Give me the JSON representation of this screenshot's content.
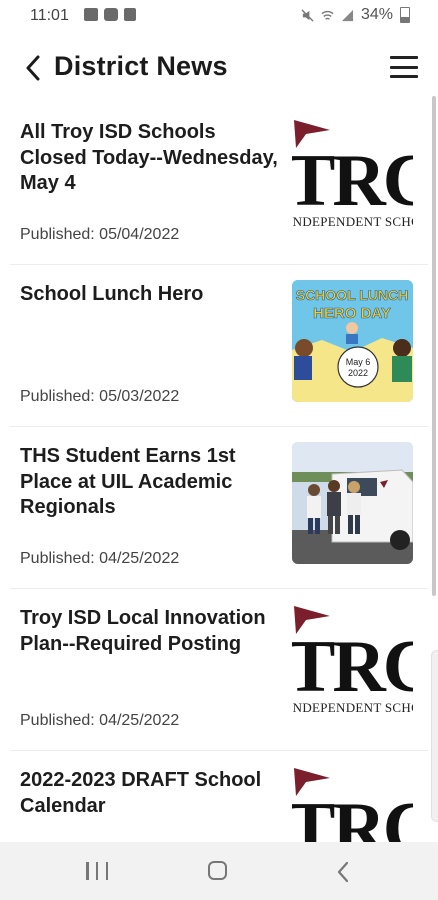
{
  "status_bar": {
    "time": "11:01",
    "battery": "34%",
    "notification_icons": [
      "image-icon",
      "youtube-icon",
      "app-icon"
    ],
    "system_icons": [
      "mute-icon",
      "wifi-icon",
      "signal-icon",
      "battery-icon"
    ]
  },
  "app_bar": {
    "title": "District News",
    "back_icon": "back-arrow-icon",
    "menu_icon": "hamburger-menu-icon"
  },
  "news": [
    {
      "headline": "All Troy ISD Schools Closed Today--Wednesday, May 4",
      "published": "Published: 05/04/2022",
      "thumbnail": "troy-isd-logo"
    },
    {
      "headline": "School Lunch Hero",
      "published": "Published: 05/03/2022",
      "thumbnail": "school-lunch-hero-day-image"
    },
    {
      "headline": "THS Student Earns 1st Place at UIL Academic Regionals",
      "published": "Published: 04/25/2022",
      "thumbnail": "students-photo"
    },
    {
      "headline": "Troy ISD Local Innovation Plan--Required Posting",
      "published": "Published: 04/25/2022",
      "thumbnail": "troy-isd-logo"
    },
    {
      "headline": "2022-2023 DRAFT School Calendar",
      "published": "",
      "thumbnail": "troy-isd-logo"
    }
  ],
  "logo_text": {
    "big": "TRC",
    "small": "INDEPENDENT SCHOOL"
  },
  "lunch_image_text": {
    "title1": "SCHOOL LUNCH",
    "title2": "HERO DAY",
    "date1": "May 6",
    "date2": "2022"
  },
  "colors": {
    "flag": "#7a1f2b",
    "accent_text": "#1b1b1b",
    "lunch_bg": "#6fc6e8",
    "lunch_title": "#f4d21f"
  },
  "nav_bar": {
    "icons": [
      "recent-apps-icon",
      "home-icon",
      "back-icon"
    ]
  }
}
